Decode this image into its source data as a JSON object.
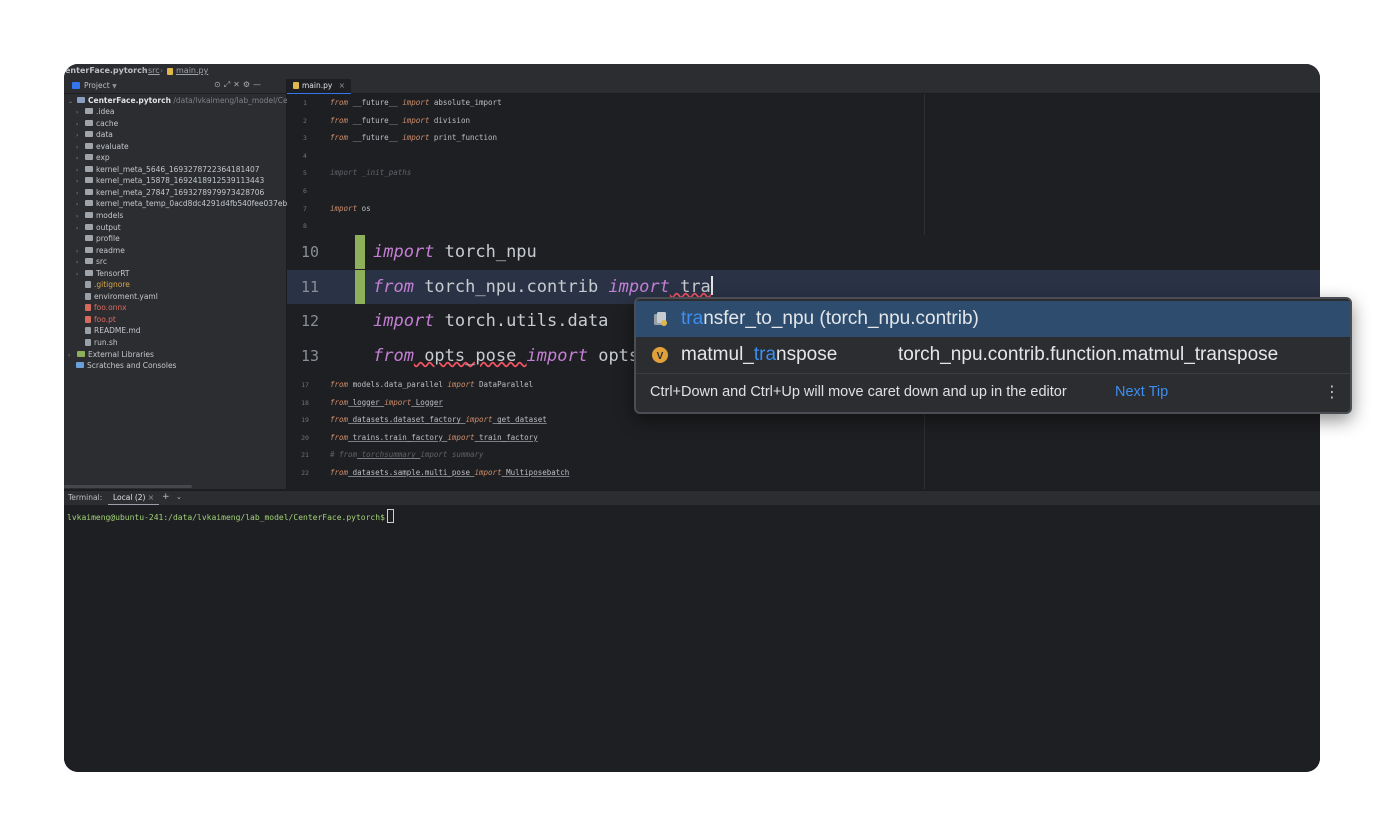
{
  "breadcrumb": {
    "project": "enterFace.pytorch",
    "folder": "src",
    "file": "main.py"
  },
  "sidebar": {
    "title": "Project",
    "root": "CenterFace.pytorch",
    "root_path": "/data/lvkaimeng/lab_model/Cen",
    "items": [
      {
        "label": ".idea",
        "kind": "folder"
      },
      {
        "label": "cache",
        "kind": "folder"
      },
      {
        "label": "data",
        "kind": "folder"
      },
      {
        "label": "evaluate",
        "kind": "folder"
      },
      {
        "label": "exp",
        "kind": "folder"
      },
      {
        "label": "kernel_meta_5646_1693278722364181407",
        "kind": "folder"
      },
      {
        "label": "kernel_meta_15878_1692418912539113443",
        "kind": "folder"
      },
      {
        "label": "kernel_meta_27847_1693278979973428706",
        "kind": "folder"
      },
      {
        "label": "kernel_meta_temp_0acd8dc4291d4fb540fee037ebb",
        "kind": "folder"
      },
      {
        "label": "models",
        "kind": "folder"
      },
      {
        "label": "output",
        "kind": "folder"
      },
      {
        "label": "profile",
        "kind": "folder-noarrow"
      },
      {
        "label": "readme",
        "kind": "folder"
      },
      {
        "label": "src",
        "kind": "folder"
      },
      {
        "label": "TensorRT",
        "kind": "folder"
      },
      {
        "label": ".gitignore",
        "kind": "file"
      },
      {
        "label": "enviroment.yaml",
        "kind": "file"
      },
      {
        "label": "foo.onnx",
        "kind": "file-red"
      },
      {
        "label": "foo.pt",
        "kind": "file-red"
      },
      {
        "label": "README.md",
        "kind": "file"
      },
      {
        "label": "run.sh",
        "kind": "file"
      }
    ],
    "external": "External Libraries",
    "scratches": "Scratches and Consoles"
  },
  "editor": {
    "tab": "main.py",
    "lines_top": [
      {
        "n": "1",
        "a": "from",
        "b": " __future__ ",
        "c": "import",
        "d": " absolute_import"
      },
      {
        "n": "2",
        "a": "from",
        "b": " __future__ ",
        "c": "import",
        "d": " division"
      },
      {
        "n": "3",
        "a": "from",
        "b": " __future__ ",
        "c": "import",
        "d": " print_function"
      },
      {
        "n": "4",
        "a": "",
        "b": "",
        "c": "",
        "d": ""
      },
      {
        "n": "5",
        "a": "",
        "b": "import _init_paths",
        "c": "",
        "d": ""
      },
      {
        "n": "6",
        "a": "",
        "b": "",
        "c": "",
        "d": ""
      },
      {
        "n": "7",
        "a": "import",
        "b": " os",
        "c": "",
        "d": ""
      },
      {
        "n": "8",
        "a": "",
        "b": "",
        "c": "",
        "d": ""
      }
    ],
    "zoom_lines": [
      {
        "n": "10",
        "kw1": "import",
        "rest": " torch_npu"
      },
      {
        "n": "11",
        "kw1": "from",
        "mid": " torch_npu.contrib ",
        "kw2": "import",
        "rest": " tra"
      },
      {
        "n": "12",
        "kw1": "import",
        "rest": " torch.utils.data"
      },
      {
        "n": "13",
        "kw1": "from",
        "mid": " opts_pose ",
        "kw2": "import",
        "rest": " opts"
      }
    ],
    "lines_bottom": [
      {
        "n": "17",
        "a": "from",
        "b": " models.data_parallel ",
        "c": "import",
        "d": " DataParallel"
      },
      {
        "n": "18",
        "a": "from",
        "b": " logger ",
        "c": "import",
        "d": " Logger"
      },
      {
        "n": "19",
        "a": "from",
        "b": " datasets.dataset_factory ",
        "c": "import",
        "d": " get_dataset"
      },
      {
        "n": "20",
        "a": "from",
        "b": " trains.train_factory ",
        "c": "import",
        "d": " train_factory"
      },
      {
        "n": "21",
        "a": "# from",
        "b": " torchsummary ",
        "c": "import",
        "d": " summary"
      },
      {
        "n": "22",
        "a": "from",
        "b": " datasets.sample.multi_pose ",
        "c": "import",
        "d": " Multiposebatch"
      }
    ]
  },
  "completion": {
    "items": [
      {
        "hl": "tra",
        "rest": "nsfer_to_npu (torch_npu.contrib)",
        "right": ""
      },
      {
        "pre": "matmul_",
        "hl": "tra",
        "rest": "nspose",
        "right": "torch_npu.contrib.function.matmul_transpose"
      }
    ],
    "tip": "Ctrl+Down and Ctrl+Up will move caret down and up in the editor",
    "next_tip": "Next Tip"
  },
  "terminal": {
    "label": "Terminal:",
    "tab": "Local (2)",
    "prompt": "lvkaimeng@ubuntu-241:/data/lvkaimeng/lab_model/CenterFace.pytorch$"
  },
  "colors": {
    "accent": "#3574f0",
    "completion_highlight": "#3d8ef0",
    "change_marker": "#8fb05b"
  }
}
